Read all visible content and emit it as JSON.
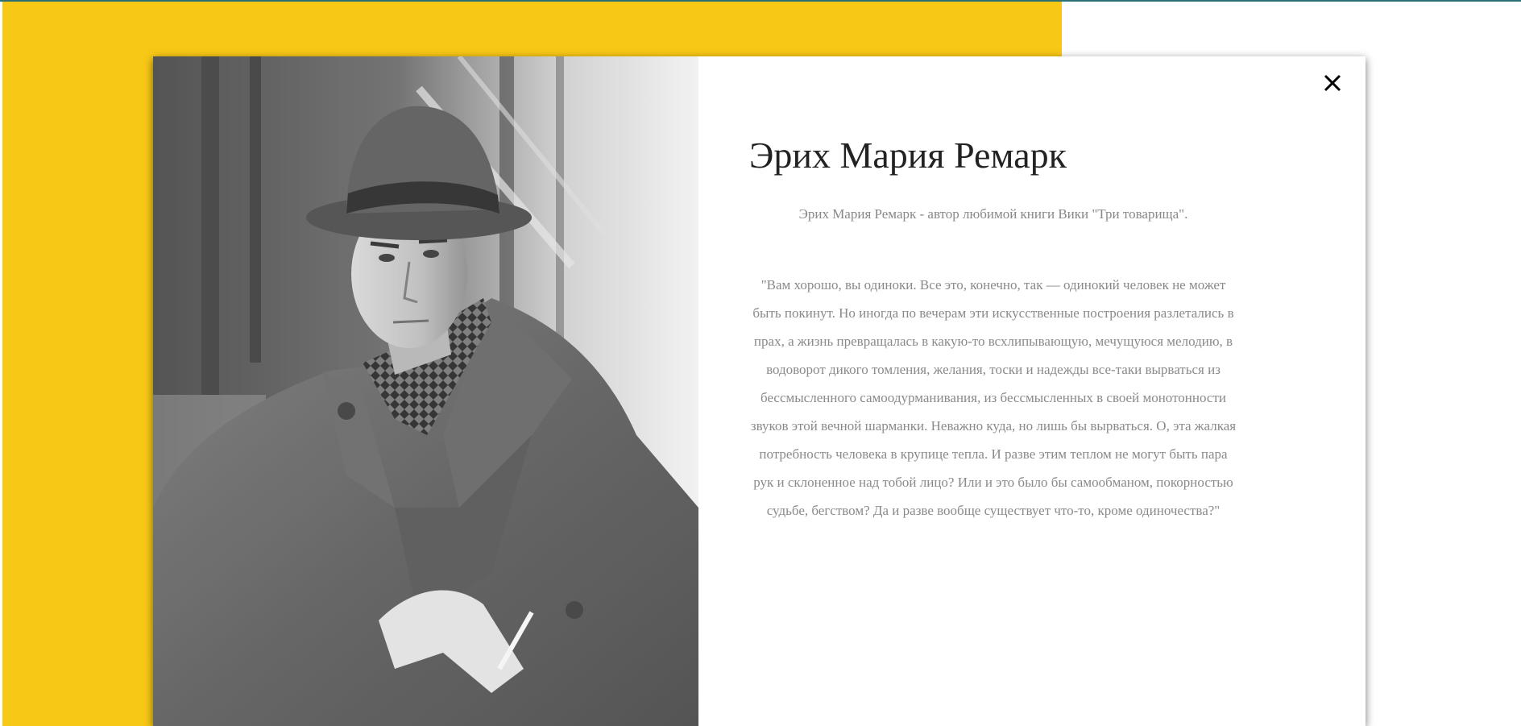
{
  "colors": {
    "accent_yellow": "#f8c816",
    "top_rule": "#2b6f75",
    "title_text": "#222222",
    "body_text": "#8a8a8a"
  },
  "modal": {
    "photo": {
      "subject": "black-and-white portrait of a man in a hat and coat holding a cigarette"
    },
    "close_icon": "close-icon",
    "title": "Эрих Мария Ремарк",
    "subtitle": "Эрих Мария Ремарк - автор любимой книги Вики \"Три товарища\".",
    "quote": "\"Вам хорошо, вы одиноки. Все это, конечно, так — одинокий человек не может быть покинут. Но иногда по вечерам эти искусственные построения разлетались в прах, а жизнь превращалась в какую-то всхлипывающую, мечущуюся мелодию, в водоворот дикого томления, желания, тоски и надежды все-таки вырваться из бессмысленного самоодурманивания, из бессмысленных в своей монотонности звуков этой вечной шарманки. Неважно куда, но лишь бы вырваться. О, эта жалкая потребность человека в крупице тепла. И разве этим теплом не могут быть пара рук и склоненное над тобой лицо? Или и это было бы самообманом, покорностью судьбе, бегством? Да и разве вообще существует что-то, кроме одиночества?\""
  }
}
